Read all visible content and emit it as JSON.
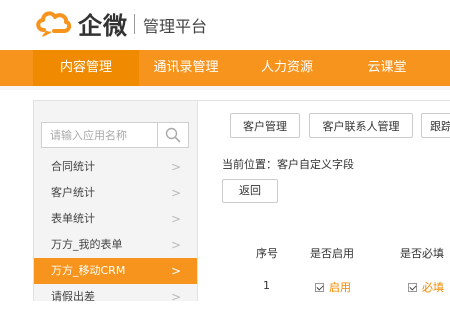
{
  "header": {
    "logo_icon": "cloud-chat-icon",
    "logo_text": "企微",
    "platform_title": "管理平台",
    "brand_color": "#f7941d"
  },
  "nav": {
    "tabs": [
      {
        "label": "内容管理",
        "active": true
      },
      {
        "label": "通讯录管理",
        "active": false
      },
      {
        "label": "人力资源",
        "active": false
      },
      {
        "label": "云课堂",
        "active": false
      }
    ]
  },
  "sidebar": {
    "search_placeholder": "请输入应用名称",
    "search_icon": "search-icon",
    "items": [
      {
        "label": "合同统计",
        "active": false
      },
      {
        "label": "客户统计",
        "active": false
      },
      {
        "label": "表单统计",
        "active": false
      },
      {
        "label": "万方_我的表单",
        "active": false
      },
      {
        "label": "万方_移动CRM",
        "active": true
      },
      {
        "label": "请假出差",
        "active": false
      }
    ]
  },
  "main": {
    "subtabs": [
      "客户管理",
      "客户联系人管理",
      "跟踪"
    ],
    "breadcrumb": "当前位置：客户自定义字段",
    "back_label": "返回",
    "table": {
      "headers": [
        "序号",
        "是否启用",
        "是否必填"
      ],
      "rows": [
        {
          "index": "1",
          "enabled_label": "启用",
          "enabled": true,
          "required_label": "必填",
          "required": true
        }
      ]
    }
  }
}
